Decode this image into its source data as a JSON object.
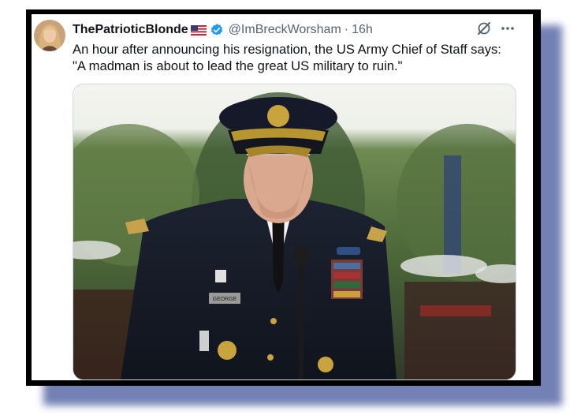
{
  "post": {
    "display_name": "ThePatrioticBlonde",
    "name_flag": "🇺🇸",
    "handle": "@ImBreckWorsham",
    "separator": "·",
    "time": "16h",
    "text_line1": "An hour after announcing his resignation, the US Army Chief of Staff says:",
    "text_line2": "\"A madman is about to lead the great US military to ruin.\"",
    "media_name_tag": "GEORGE",
    "media_description": "uniformed army general at a microphone"
  },
  "icons": {
    "verified": "verified-badge-icon",
    "grok": "grok-icon",
    "more": "more-options-icon"
  },
  "colors": {
    "verified": "#1d9bf0",
    "frame": "#000000",
    "shadow": "#5a6aa8"
  }
}
